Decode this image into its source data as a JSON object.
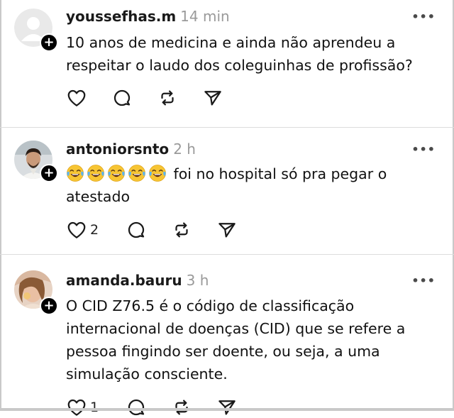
{
  "posts": [
    {
      "username": "youssefhas.m",
      "time": "14 min",
      "more": "•••",
      "text": "10 anos de medicina e ainda não aprendeu a respeitar o laudo dos coleguinhas de profissão?",
      "like_count": "",
      "avatar": "default-avatar"
    },
    {
      "username": "antoniorsnto",
      "time": "2 h",
      "more": "•••",
      "emoji": "tears-of-joy-emoji",
      "emoji_count": 5,
      "text": "foi no hospital só pra pegar o atestado",
      "like_count": "2",
      "avatar": "photo-avatar"
    },
    {
      "username": "amanda.bauru",
      "time": "3 h",
      "more": "•••",
      "text": "O CID Z76.5 é o código de classificação internacional de doenças (CID) que se refere a pessoa fingindo ser doente, ou seja, a uma simulação consciente.",
      "like_count": "1",
      "avatar": "photo-avatar"
    }
  ],
  "follow_symbol": "+",
  "colors": {
    "text": "#111111",
    "muted": "#9a9a9a",
    "divider": "#dcdcdc",
    "badge": "#000000"
  }
}
